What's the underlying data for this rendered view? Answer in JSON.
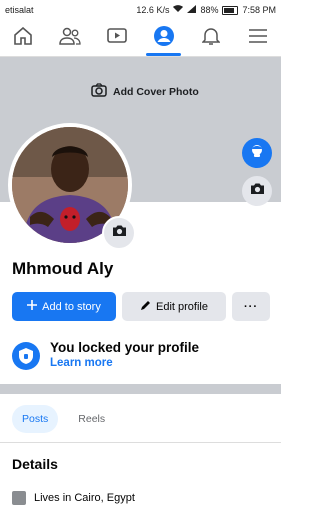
{
  "status_bar": {
    "carrier": "etisalat",
    "speed": "12.6 K/s",
    "battery": "88%",
    "time": "7:58 PM"
  },
  "nav": {
    "items": [
      "home",
      "friends",
      "watch",
      "profile",
      "notifications",
      "menu"
    ],
    "active": "profile"
  },
  "cover": {
    "add_label": "Add Cover Photo"
  },
  "profile": {
    "name": "Mhmoud Aly"
  },
  "actions": {
    "add_story": "Add to story",
    "edit_profile": "Edit profile",
    "more": "···"
  },
  "locked": {
    "title": "You locked your profile",
    "link": "Learn more"
  },
  "tabs": [
    {
      "label": "Posts",
      "active": true
    },
    {
      "label": "Reels",
      "active": false
    }
  ],
  "details": {
    "title": "Details",
    "lives_in": "Lives in Cairo, Egypt"
  },
  "colors": {
    "accent": "#1877f2",
    "cover": "#c9ccd1",
    "button_grey": "#e4e6eb"
  }
}
